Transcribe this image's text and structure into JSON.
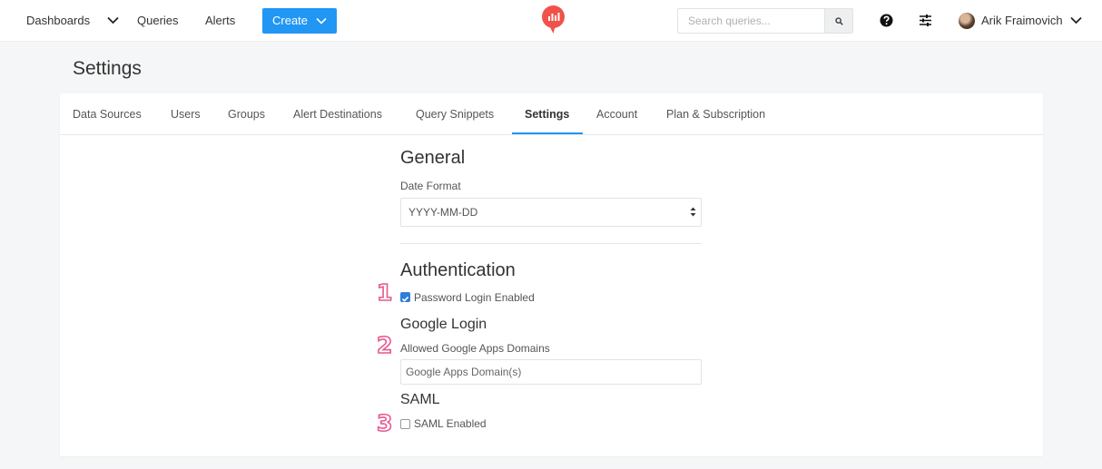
{
  "nav": {
    "dashboards": "Dashboards",
    "queries": "Queries",
    "alerts": "Alerts",
    "create": "Create",
    "search_placeholder": "Search queries...",
    "user_name": "Arik Fraimovich"
  },
  "page": {
    "title": "Settings"
  },
  "tabs": [
    {
      "label": "Data Sources"
    },
    {
      "label": "Users"
    },
    {
      "label": "Groups"
    },
    {
      "label": "Alert Destinations"
    },
    {
      "label": "Query Snippets"
    },
    {
      "label": "Settings",
      "active": true
    },
    {
      "label": "Account"
    },
    {
      "label": "Plan & Subscription"
    }
  ],
  "general": {
    "heading": "General",
    "date_format_label": "Date Format",
    "date_format_value": "YYYY-MM-DD"
  },
  "auth": {
    "heading": "Authentication",
    "password_login_label": "Password Login Enabled",
    "password_login_checked": true,
    "google_heading": "Google Login",
    "google_domains_label": "Allowed Google Apps Domains",
    "google_domains_placeholder": "Google Apps Domain(s)",
    "saml_heading": "SAML",
    "saml_label": "SAML Enabled",
    "saml_checked": false
  },
  "annotations": [
    "1",
    "2",
    "3"
  ],
  "colors": {
    "accent": "#2196f3",
    "logo": "#f0524a",
    "annotation": "#e7588e"
  },
  "icons": [
    "chevron-down-icon",
    "redash-logo-icon",
    "search-icon",
    "help-icon",
    "settings-sliders-icon",
    "avatar",
    "select-arrows-icon",
    "checkbox-checked-icon"
  ]
}
